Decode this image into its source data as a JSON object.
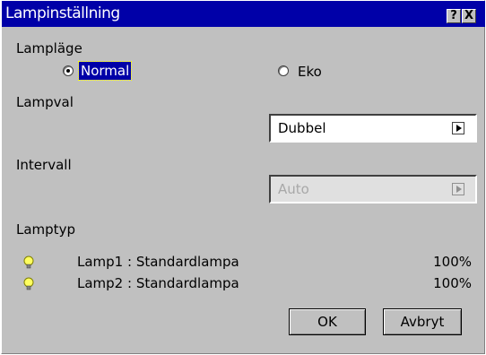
{
  "window": {
    "title": "Lampinställning",
    "help_glyph": "?",
    "close_glyph": "X"
  },
  "lamp_mode": {
    "label": "Lampläge",
    "options": [
      {
        "label": "Normal",
        "selected": true
      },
      {
        "label": "Eko",
        "selected": false
      }
    ]
  },
  "lamp_select": {
    "label": "Lampval",
    "value": "Dubbel"
  },
  "interval": {
    "label": "Intervall",
    "value": "Auto",
    "disabled": true
  },
  "lamp_type": {
    "label": "Lamptyp",
    "lamps": [
      {
        "name": "Lamp1 : Standardlampa",
        "percent": "100%",
        "icon": "bulb-icon"
      },
      {
        "name": "Lamp2 : Standardlampa",
        "percent": "100%",
        "icon": "bulb-icon"
      }
    ]
  },
  "buttons": {
    "ok": "OK",
    "cancel": "Avbryt"
  },
  "colors": {
    "titlebar": "#0000a8",
    "dialog_bg": "#c0c0c0",
    "bulb": "#ffff60"
  }
}
